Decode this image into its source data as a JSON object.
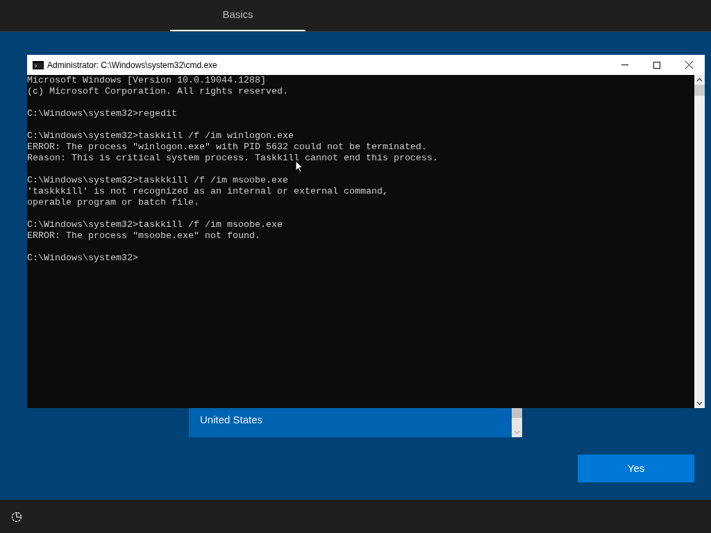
{
  "header": {
    "tabs": [
      {
        "label": "Basics",
        "selected": true
      }
    ]
  },
  "console_window": {
    "title": "Administrator: C:\\Windows\\system32\\cmd.exe",
    "blocks": [
      [
        "Microsoft Windows [Version 10.0.19044.1288]",
        "(c) Microsoft Corporation. All rights reserved."
      ],
      [
        "C:\\Windows\\system32>regedit"
      ],
      [
        "C:\\Windows\\system32>taskkill /f /im winlogon.exe",
        "ERROR: The process \"winlogon.exe\" with PID 5632 could not be terminated.",
        "Reason: This is critical system process. Taskkill cannot end this process."
      ],
      [
        "C:\\Windows\\system32>taskkkill /f /im msoobe.exe",
        "'taskkkill' is not recognized as an internal or external command,",
        "operable program or batch file."
      ],
      [
        "C:\\Windows\\system32>taskkill /f /im msoobe.exe",
        "ERROR: The process \"msoobe.exe\" not found."
      ],
      [
        "C:\\Windows\\system32>"
      ]
    ]
  },
  "region_list": {
    "items": [
      {
        "label": "United States",
        "selected": true
      }
    ]
  },
  "buttons": [
    {
      "label": "Yes"
    }
  ]
}
